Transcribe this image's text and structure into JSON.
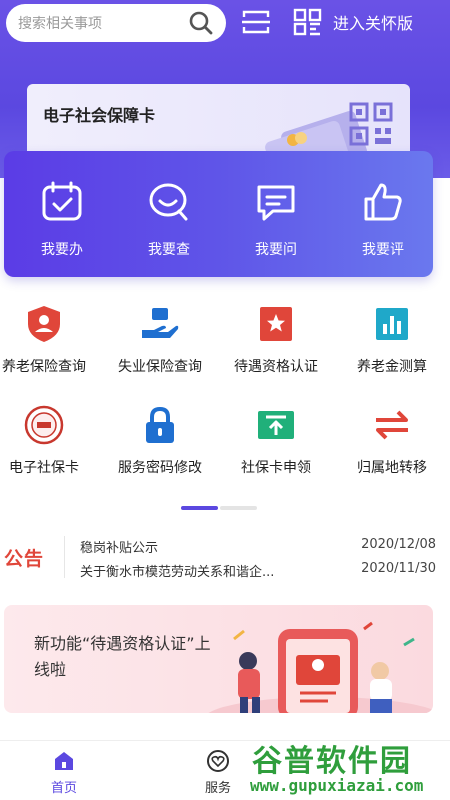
{
  "header": {
    "search_placeholder": "搜索相关事项",
    "care_mode_label": "进入关怀版"
  },
  "card_banner": {
    "title": "电子社会保障卡"
  },
  "quick_actions": [
    {
      "label": "我要办",
      "icon": "calendar-check-icon"
    },
    {
      "label": "我要查",
      "icon": "search-chat-icon"
    },
    {
      "label": "我要问",
      "icon": "chat-bubble-icon"
    },
    {
      "label": "我要评",
      "icon": "thumbs-up-icon"
    }
  ],
  "services": [
    {
      "label": "养老保险查询",
      "icon": "shield-person-icon",
      "color": "#e0463a"
    },
    {
      "label": "失业保险查询",
      "icon": "hand-coin-icon",
      "color": "#1f6fd0"
    },
    {
      "label": "待遇资格认证",
      "icon": "star-badge-icon",
      "color": "#e0463a"
    },
    {
      "label": "养老金测算",
      "icon": "bar-chart-icon",
      "color": "#1fa8c9"
    },
    {
      "label": "电子社保卡",
      "icon": "seal-icon",
      "color": "#c8382e"
    },
    {
      "label": "服务密码修改",
      "icon": "lock-icon",
      "color": "#1f6fd0"
    },
    {
      "label": "社保卡申领",
      "icon": "upload-card-icon",
      "color": "#20b07a"
    },
    {
      "label": "归属地转移",
      "icon": "transfer-arrows-icon",
      "color": "#e0463a"
    }
  ],
  "notice": {
    "logo": "公告",
    "items": [
      {
        "title": "稳岗补贴公示",
        "date": "2020/12/08"
      },
      {
        "title": "关于衡水市模范劳动关系和谐企...",
        "date": "2020/11/30"
      }
    ]
  },
  "promo": {
    "text": "新功能“待遇资格认证”上线啦"
  },
  "tabbar": [
    {
      "label": "首页",
      "icon": "home-icon",
      "active": true
    },
    {
      "label": "服务",
      "icon": "heart-service-icon",
      "active": false
    }
  ],
  "watermark": {
    "name": "谷普软件园",
    "url": "www.gupuxiazai.com"
  },
  "colors": {
    "brand": "#5b48e0",
    "accent_red": "#e0463a",
    "watermark_green": "#2f9e3c"
  }
}
